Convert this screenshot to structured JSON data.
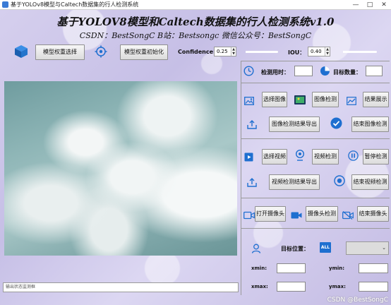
{
  "window": {
    "title": "基于YOLOv8模型与Caltech数据集的行人检测系统",
    "controls": [
      "—",
      "□",
      "✕"
    ]
  },
  "header": {
    "title": "基于YOLOV8模型和Caltech数据集的行人检测系统v1.0",
    "subtitle": "CSDN：BestSongC   B站：Bestsongc   微信公众号：BestSongC"
  },
  "toolbar": {
    "model_select_label": "模型权重选择",
    "model_init_label": "模型权重初始化",
    "confidence_label": "Confidence:",
    "confidence_value": "0.25",
    "iou_label": "IOU：",
    "iou_value": "0.40",
    "confidence_level": 0.25,
    "iou_level": 0.4
  },
  "stats": {
    "time_label": "检测用时：",
    "time_value": "",
    "count_label": "目标数量：",
    "count_value": ""
  },
  "image_section": {
    "select_label": "选择图像",
    "detect_label": "图像检测",
    "result_label": "结果展示",
    "export_label": "图像检测结果导出",
    "end_label": "结束图像检测"
  },
  "video_section": {
    "select_label": "选择视频",
    "detect_label": "视频检测",
    "pause_label": "暂停检测",
    "export_label": "视频检测结果导出",
    "end_label": "结束视频检测"
  },
  "camera_section": {
    "open_label": "打开摄像头",
    "detect_label": "摄像头检测",
    "end_label": "结束摄像头"
  },
  "target": {
    "position_label": "目标位置：",
    "all_badge": "ALL",
    "xmin_label": "xmin:",
    "ymin_label": "ymin:",
    "xmax_label": "xmax:",
    "ymax_label": "ymax:"
  },
  "status": {
    "placeholder": "输出状态监测框"
  },
  "watermark": "CSDN @BestSongC",
  "colors": {
    "accent_blue": "#1e6fd0",
    "background": "#cfc8ec"
  }
}
